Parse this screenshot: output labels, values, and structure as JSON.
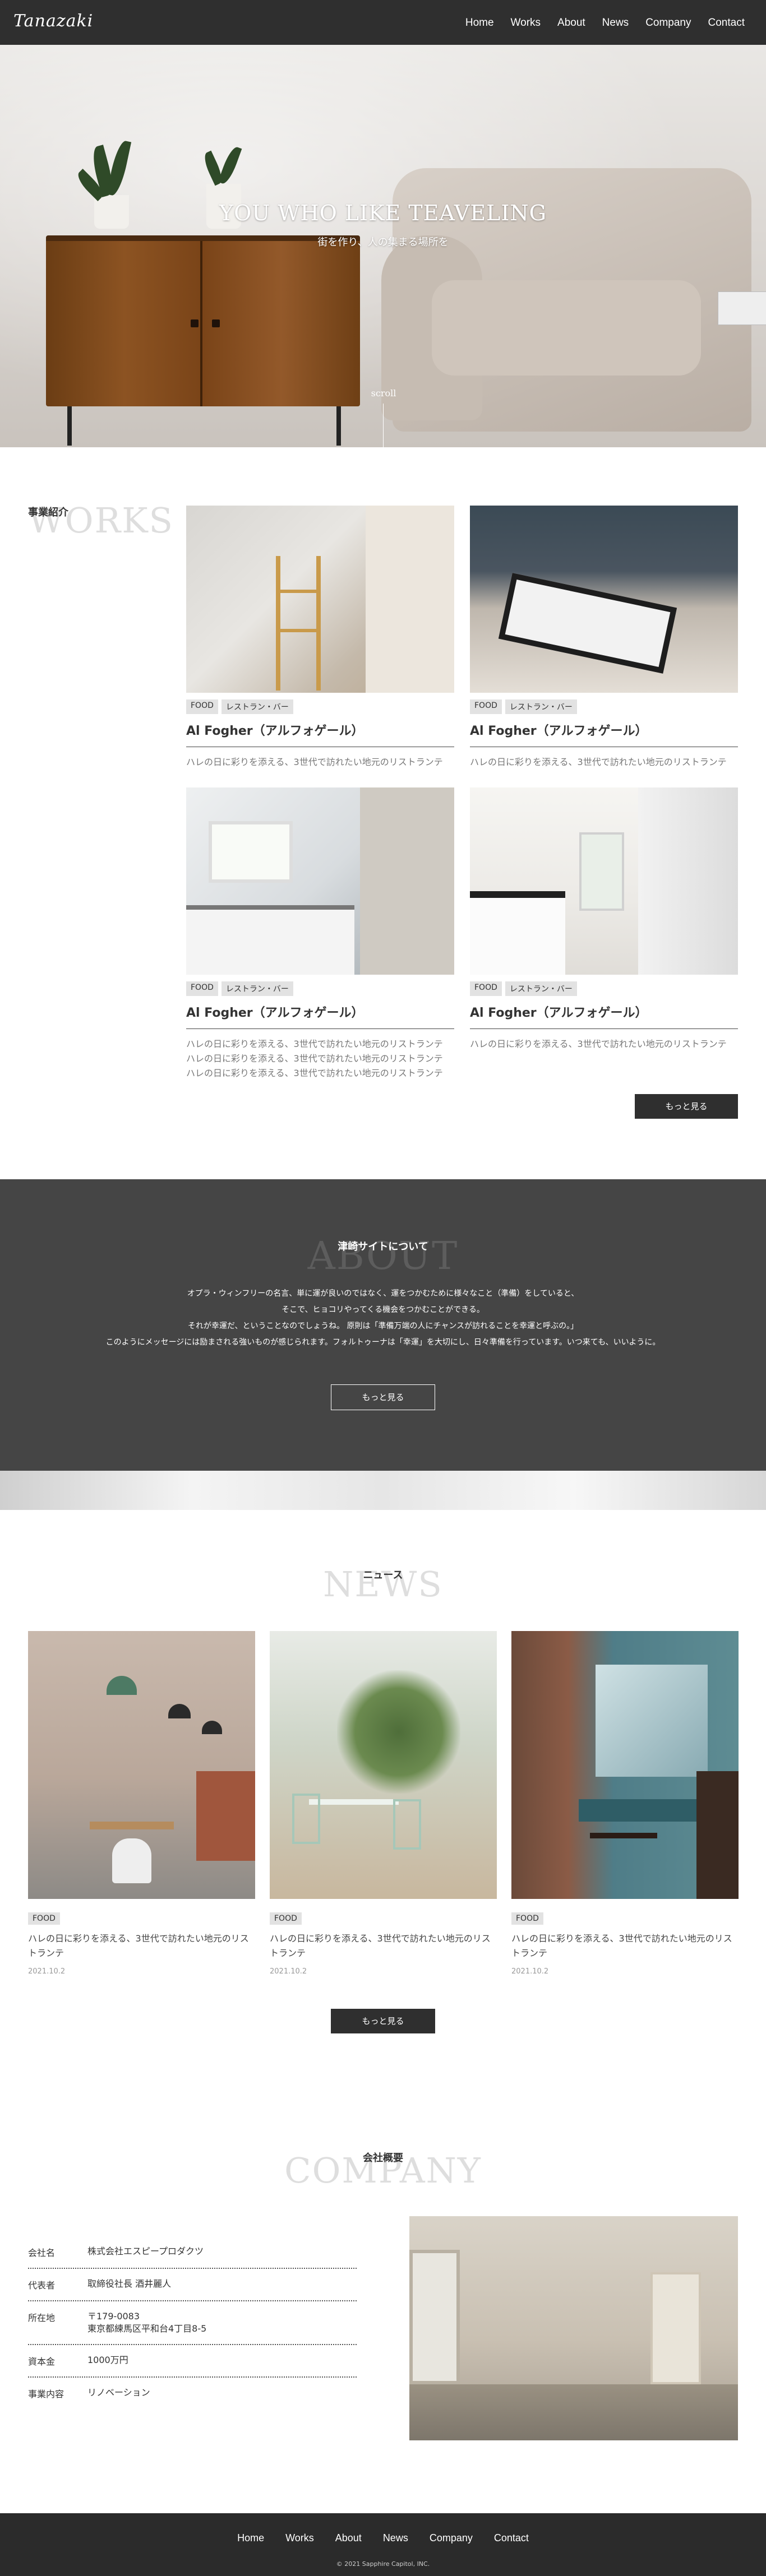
{
  "header": {
    "logo": "Tanazaki",
    "nav": [
      "Home",
      "Works",
      "About",
      "News",
      "Company",
      "Contact"
    ]
  },
  "hero": {
    "title": "YOU WHO LIKE TEAVELING",
    "subtitle": "街を作り、人の集まる場所を",
    "scroll": "scroll"
  },
  "works": {
    "label": "事業紹介",
    "ghost": "WORKS",
    "cards": [
      {
        "tags": [
          "FOOD",
          "レストラン・バー"
        ],
        "title": "Al Fogher（アルフォゲール）",
        "desc": [
          "ハレの日に彩りを添える、3世代で訪れたい地元のリストランテ"
        ]
      },
      {
        "tags": [
          "FOOD",
          "レストラン・バー"
        ],
        "title": "Al Fogher（アルフォゲール）",
        "desc": [
          "ハレの日に彩りを添える、3世代で訪れたい地元のリストランテ"
        ]
      },
      {
        "tags": [
          "FOOD",
          "レストラン・バー"
        ],
        "title": "Al Fogher（アルフォゲール）",
        "desc": [
          "ハレの日に彩りを添える、3世代で訪れたい地元のリストランテ",
          "ハレの日に彩りを添える、3世代で訪れたい地元のリストランテ",
          "ハレの日に彩りを添える、3世代で訪れたい地元のリストランテ"
        ]
      },
      {
        "tags": [
          "FOOD",
          "レストラン・バー"
        ],
        "title": "Al Fogher（アルフォゲール）",
        "desc": [
          "ハレの日に彩りを添える、3世代で訪れたい地元のリストランテ"
        ]
      }
    ],
    "more": "もっと見る"
  },
  "about": {
    "label": "津崎サイトについて",
    "ghost": "ABOUT",
    "lines": [
      "オプラ・ウィンフリーの名言、単に運が良いのではなく、運をつかむために様々なこと（準備）をしていると、",
      "そこで、ヒョコリやってくる機会をつかむことができる。",
      "それが幸運だ、ということなのでしょうね。 原則は「準備万端の人にチャンスが訪れることを幸運と呼ぶの。」",
      "このようにメッセージには励まされる強いものが感じられます。フォルトゥーナは「幸運」を大切にし、日々準備を行っています。いつ来ても、いいように。"
    ],
    "more": "もっと見る"
  },
  "news": {
    "label": "ニュース",
    "ghost": "NEWS",
    "items": [
      {
        "tag": "FOOD",
        "desc": "ハレの日に彩りを添える、3世代で訪れたい地元のリストランテ",
        "date": "2021.10.2"
      },
      {
        "tag": "FOOD",
        "desc": "ハレの日に彩りを添える、3世代で訪れたい地元のリストランテ",
        "date": "2021.10.2"
      },
      {
        "tag": "FOOD",
        "desc": "ハレの日に彩りを添える、3世代で訪れたい地元のリストランテ",
        "date": "2021.10.2"
      }
    ],
    "more": "もっと見る"
  },
  "company": {
    "label": "会社概要",
    "ghost": "COMPANY",
    "rows": [
      {
        "k": "会社名",
        "v": [
          "株式会社エスピープロダクツ"
        ]
      },
      {
        "k": "代表者",
        "v": [
          "取締役社長 酒井麗人"
        ]
      },
      {
        "k": "所在地",
        "v": [
          "〒179-0083",
          "東京都練馬区平和台4丁目8-5"
        ]
      },
      {
        "k": "資本金",
        "v": [
          "1000万円"
        ]
      },
      {
        "k": "事業内容",
        "v": [
          "リノベーション"
        ]
      }
    ]
  },
  "footer": {
    "nav": [
      "Home",
      "Works",
      "About",
      "News",
      "Company",
      "Contact"
    ],
    "copyright": "© 2021 Sapphire Capitol, INC."
  }
}
